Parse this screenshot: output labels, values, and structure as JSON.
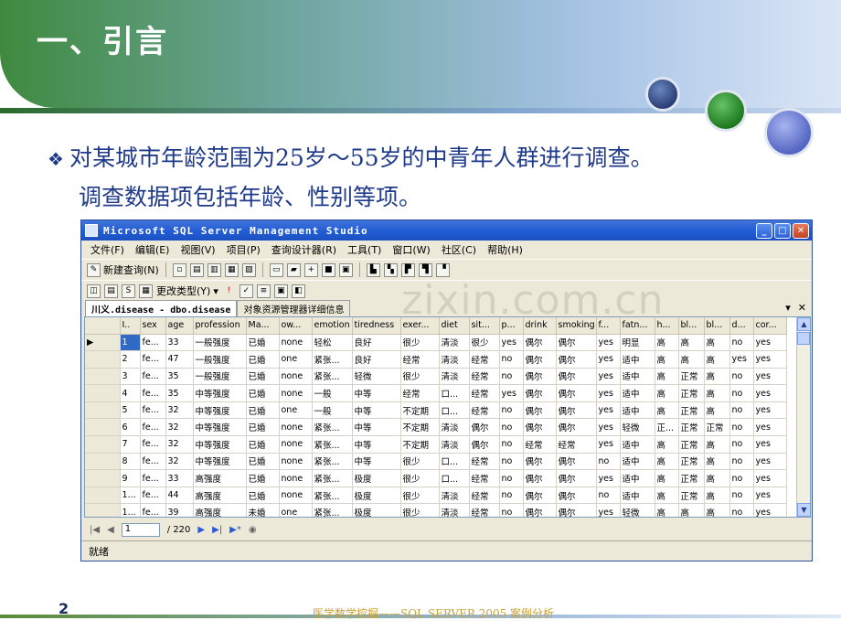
{
  "slide": {
    "title": "一、引言",
    "bullet_line1": "对某城市年龄范围为25岁～55岁的中青年人群进行调查。",
    "bullet_line2": "调查数据项包括年龄、性别等项。",
    "page_number": "2",
    "footer": "医学数学挖掘——SQL SERVER 2005 案例分析",
    "watermark": "zixin.com.cn"
  },
  "window": {
    "title": "Microsoft SQL Server Management Studio",
    "menu": [
      "文件(F)",
      "编辑(E)",
      "视图(V)",
      "项目(P)",
      "查询设计器(R)",
      "工具(T)",
      "窗口(W)",
      "社区(C)",
      "帮助(H)"
    ],
    "toolbar1": {
      "new_query": "新建查询(N)"
    },
    "toolbar2": {
      "change_type": "更改类型(Y)"
    },
    "tabs": [
      "川义.disease - dbo.disease",
      "对象资源管理器详细信息"
    ],
    "columns": [
      "I..",
      "sex",
      "age",
      "profession",
      "Ma...",
      "ow...",
      "emotion",
      "tiredness",
      "exer...",
      "diet",
      "sit...",
      "p...",
      "drink",
      "smoking",
      "f...",
      "fatn...",
      "h...",
      "bl...",
      "bl...",
      "d...",
      "cor..."
    ],
    "rows": [
      [
        "1",
        "fe...",
        "33",
        "一般强度",
        "已婚",
        "none",
        "轻松",
        "良好",
        "很少",
        "清淡",
        "很少",
        "yes",
        "偶尔",
        "偶尔",
        "yes",
        "明显",
        "高",
        "高",
        "高",
        "no",
        "yes"
      ],
      [
        "2",
        "fe...",
        "47",
        "一般强度",
        "已婚",
        "one",
        "紧张...",
        "良好",
        "经常",
        "清淡",
        "经常",
        "no",
        "偶尔",
        "偶尔",
        "yes",
        "适中",
        "高",
        "高",
        "高",
        "yes",
        "yes"
      ],
      [
        "3",
        "fe...",
        "35",
        "一般强度",
        "已婚",
        "none",
        "紧张...",
        "轻微",
        "很少",
        "清淡",
        "经常",
        "no",
        "偶尔",
        "偶尔",
        "yes",
        "适中",
        "高",
        "正常",
        "高",
        "no",
        "yes"
      ],
      [
        "4",
        "fe...",
        "35",
        "中等强度",
        "已婚",
        "none",
        "一般",
        "中等",
        "经常",
        "口...",
        "经常",
        "yes",
        "偶尔",
        "偶尔",
        "yes",
        "适中",
        "高",
        "正常",
        "高",
        "no",
        "yes"
      ],
      [
        "5",
        "fe...",
        "32",
        "中等强度",
        "已婚",
        "one",
        "一般",
        "中等",
        "不定期",
        "口...",
        "经常",
        "no",
        "偶尔",
        "偶尔",
        "yes",
        "适中",
        "高",
        "正常",
        "高",
        "no",
        "yes"
      ],
      [
        "6",
        "fe...",
        "32",
        "中等强度",
        "已婚",
        "none",
        "紧张...",
        "中等",
        "不定期",
        "清淡",
        "偶尔",
        "no",
        "偶尔",
        "偶尔",
        "yes",
        "轻微",
        "正...",
        "正常",
        "正常",
        "no",
        "yes"
      ],
      [
        "7",
        "fe...",
        "32",
        "中等强度",
        "已婚",
        "none",
        "紧张...",
        "中等",
        "不定期",
        "清淡",
        "偶尔",
        "no",
        "经常",
        "经常",
        "yes",
        "适中",
        "高",
        "正常",
        "高",
        "no",
        "yes"
      ],
      [
        "8",
        "fe...",
        "32",
        "中等强度",
        "已婚",
        "none",
        "紧张...",
        "中等",
        "很少",
        "口...",
        "经常",
        "no",
        "偶尔",
        "偶尔",
        "no",
        "适中",
        "高",
        "正常",
        "高",
        "no",
        "yes"
      ],
      [
        "9",
        "fe...",
        "33",
        "高强度",
        "已婚",
        "none",
        "紧张...",
        "极度",
        "很少",
        "口...",
        "经常",
        "no",
        "偶尔",
        "偶尔",
        "yes",
        "适中",
        "高",
        "正常",
        "高",
        "no",
        "yes"
      ],
      [
        "1...",
        "fe...",
        "44",
        "高强度",
        "已婚",
        "none",
        "紧张...",
        "极度",
        "很少",
        "清淡",
        "经常",
        "no",
        "偶尔",
        "偶尔",
        "no",
        "适中",
        "高",
        "正常",
        "高",
        "no",
        "yes"
      ],
      [
        "1...",
        "fe...",
        "39",
        "高强度",
        "未婚",
        "one",
        "紧张...",
        "极度",
        "很少",
        "清淡",
        "经常",
        "no",
        "偶尔",
        "偶尔",
        "yes",
        "轻微",
        "高",
        "高",
        "高",
        "no",
        "yes"
      ]
    ],
    "nav": {
      "current": "1",
      "total": "/ 220"
    },
    "status": "就绪"
  }
}
